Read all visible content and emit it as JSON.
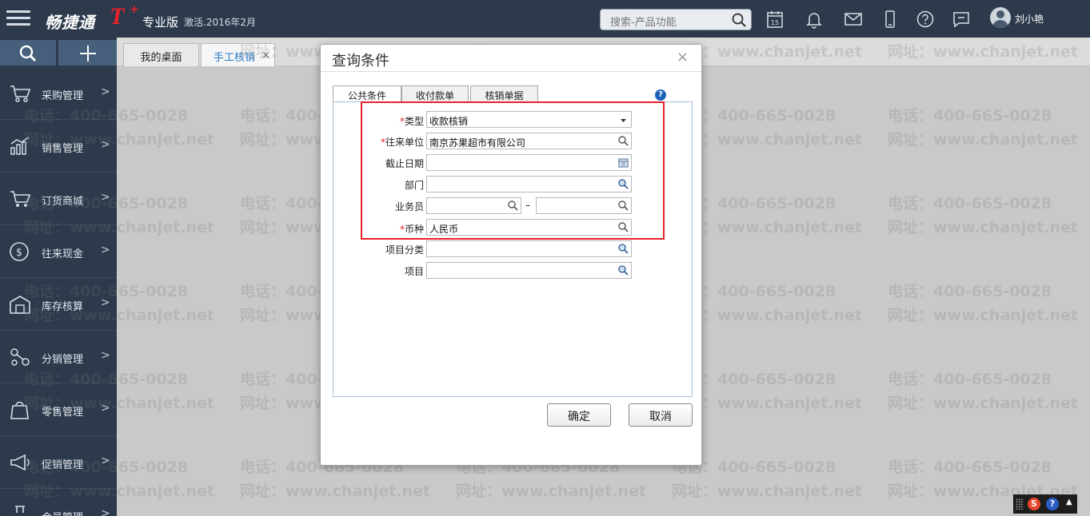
{
  "header": {
    "brand": "畅捷通",
    "brand_t": "T",
    "brand_plus": "+",
    "edition": "专业版",
    "activation": "激活.2016年2月",
    "search_placeholder": "搜索-产品功能",
    "calendar_day": "15",
    "user_name": "刘小艳"
  },
  "sidebar": {
    "items": [
      {
        "label": "采购管理",
        "icon": "cart-icon"
      },
      {
        "label": "销售管理",
        "icon": "bar-chart-icon"
      },
      {
        "label": "订货商城",
        "icon": "shopping-cart-icon"
      },
      {
        "label": "往来现金",
        "icon": "dollar-icon"
      },
      {
        "label": "库存核算",
        "icon": "warehouse-icon"
      },
      {
        "label": "分销管理",
        "icon": "distribution-icon"
      },
      {
        "label": "零售管理",
        "icon": "retail-icon"
      },
      {
        "label": "促销管理",
        "icon": "megaphone-icon"
      },
      {
        "label": "会员管理",
        "icon": "member-icon"
      }
    ]
  },
  "tabs": {
    "desktop": "我的桌面",
    "manual_writeoff": "手工核销",
    "close_glyph": "×"
  },
  "dialog": {
    "title": "查询条件",
    "close_glyph": "×",
    "tabs": [
      "公共条件",
      "收付款单",
      "核销单据"
    ],
    "help_glyph": "?",
    "required_mark": "*",
    "fields": {
      "type": {
        "label": "类型",
        "value": "收款核销"
      },
      "partner": {
        "label": "往来单位",
        "value": "南京苏果超市有限公司"
      },
      "deadline": {
        "label": "截止日期",
        "value": ""
      },
      "department": {
        "label": "部门",
        "value": ""
      },
      "salesperson": {
        "label": "业务员",
        "value_from": "",
        "value_to": "",
        "range_dash": "–"
      },
      "currency": {
        "label": "币种",
        "value": "人民币"
      },
      "project_category": {
        "label": "项目分类",
        "value": ""
      },
      "project": {
        "label": "项目",
        "value": ""
      }
    },
    "ok_label": "确定",
    "cancel_label": "取消"
  },
  "watermark": {
    "phone": "电话：400-665-0028",
    "site": "网址：www.chanjet.net"
  },
  "tray": {
    "s_glyph": "S",
    "help_glyph": "?",
    "arrow": "▲"
  },
  "colors": {
    "topbar": "#2c3a4c",
    "accent_red": "#e8212b",
    "active_tab_text": "#2a7bc2"
  }
}
